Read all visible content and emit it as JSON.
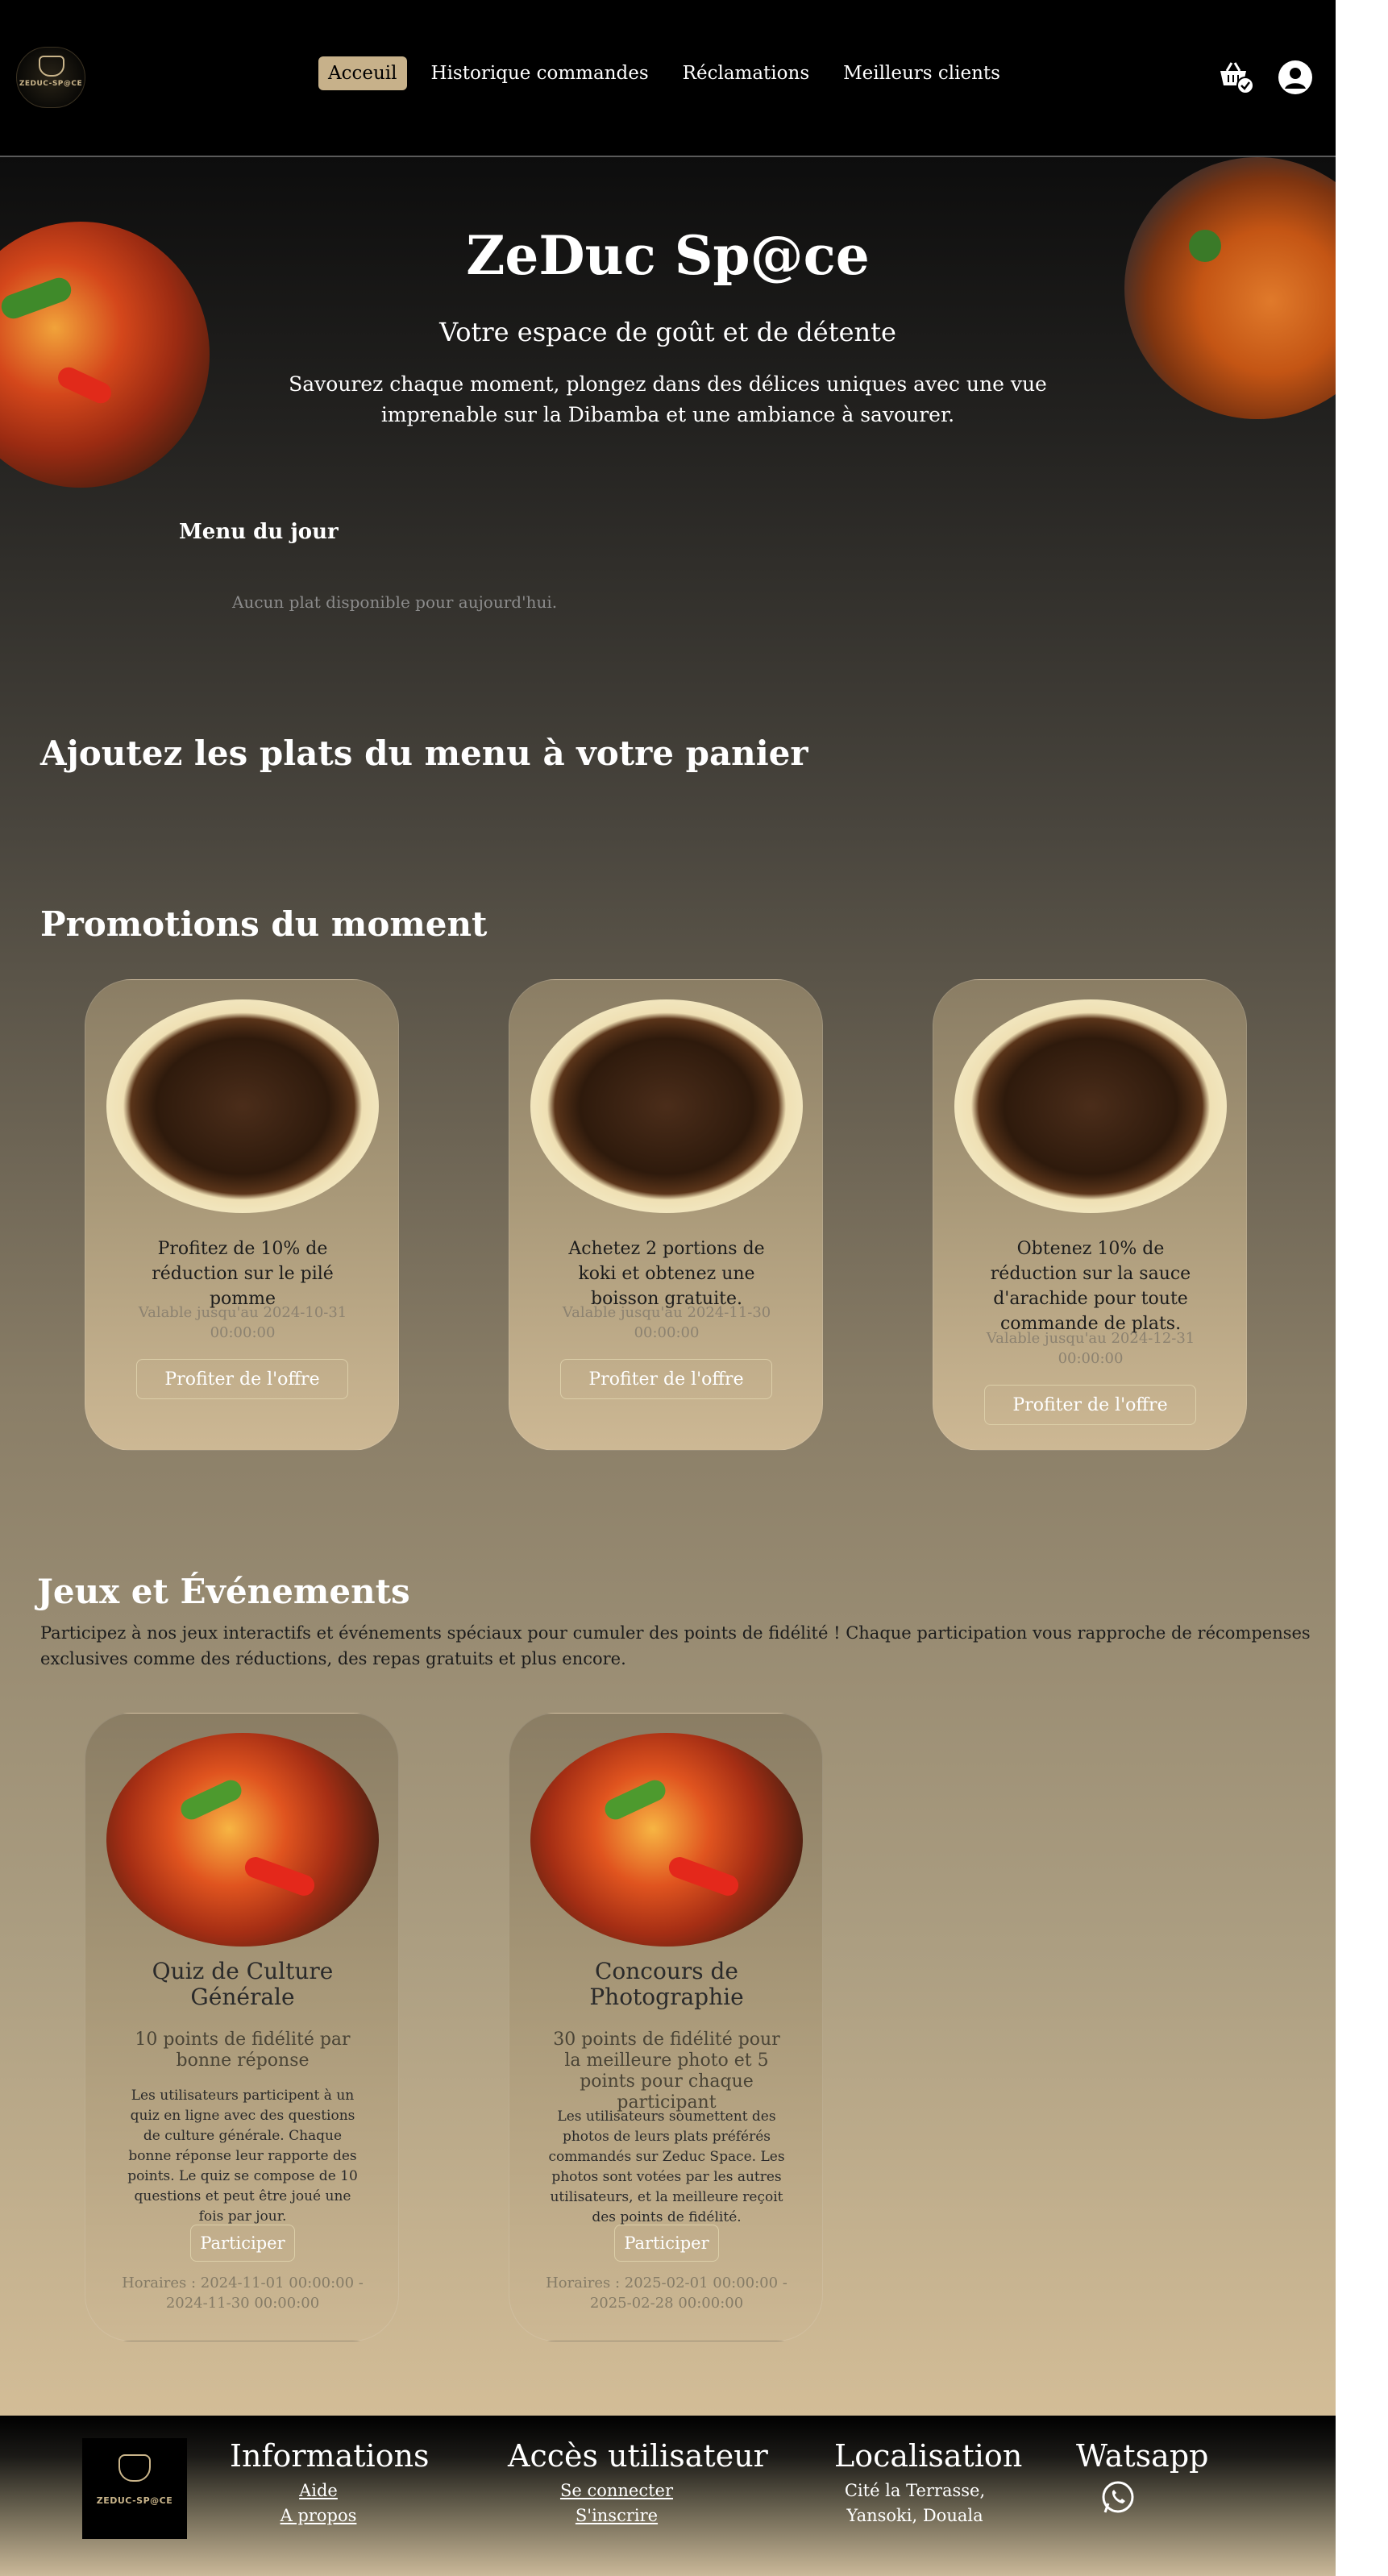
{
  "header": {
    "logo_text": "ZEDUC-SP@CE",
    "nav": [
      {
        "label": "Acceuil",
        "active": true
      },
      {
        "label": "Historique commandes"
      },
      {
        "label": "Réclamations"
      },
      {
        "label": "Meilleurs clients"
      }
    ],
    "icons": [
      "cart-check-icon",
      "user-circle-icon"
    ]
  },
  "hero": {
    "title": "ZeDuc Sp@ce",
    "subtitle": "Votre espace de goût et de détente",
    "description": "Savourez chaque moment, plongez dans des délices uniques avec une vue imprenable sur la Dibamba et une ambiance à savourer."
  },
  "menu_jour": {
    "title": "Menu du jour",
    "empty": "Aucun plat disponible pour aujourd'hui."
  },
  "panier": {
    "title": "Ajoutez les plats du menu à votre panier"
  },
  "promotions": {
    "title": "Promotions du moment",
    "button_label": "Profiter de l'offre",
    "items": [
      {
        "text": "Profitez de 10% de réduction sur le pilé pomme",
        "valid": "Valable jusqu'au 2024-10-31 00:00:00"
      },
      {
        "text": "Achetez 2 portions de koki et obtenez une boisson gratuite.",
        "valid": "Valable jusqu'au 2024-11-30 00:00:00"
      },
      {
        "text": "Obtenez 10% de réduction sur la sauce d'arachide pour toute commande de plats.",
        "valid": "Valable jusqu'au 2024-12-31 00:00:00"
      }
    ]
  },
  "events": {
    "title": "Jeux et Événements",
    "description": "Participez à nos jeux interactifs et événements spéciaux pour cumuler des points de fidélité ! Chaque participation vous rapproche de récompenses exclusives comme des réductions, des repas gratuits et plus encore.",
    "button_label": "Participer",
    "items": [
      {
        "title": "Quiz de Culture Générale",
        "points": "10 points de fidélité par bonne réponse",
        "desc": "Les utilisateurs participent à un quiz en ligne avec des questions de culture générale. Chaque bonne réponse leur rapporte des points. Le quiz se compose de 10 questions et peut être joué une fois par jour.",
        "hours": "Horaires : 2024-11-01 00:00:00 - 2024-11-30 00:00:00"
      },
      {
        "title": "Concours de Photographie",
        "points": "30 points de fidélité pour la meilleure photo et 5 points pour chaque participant",
        "desc": "Les utilisateurs soumettent des photos de leurs plats préférés commandés sur Zeduc Space. Les photos sont votées par les autres utilisateurs, et la meilleure reçoit des points de fidélité.",
        "hours": "Horaires : 2025-02-01 00:00:00 - 2025-02-28 00:00:00"
      }
    ]
  },
  "footer": {
    "logo_text": "ZEDUC-SP@CE",
    "informations": {
      "title": "Informations",
      "links": [
        "Aide",
        "A propos"
      ]
    },
    "acces": {
      "title": "Accès utilisateur",
      "links": [
        "Se connecter",
        "S'inscrire"
      ]
    },
    "localisation": {
      "title": "Localisation",
      "lines": [
        "Cité la Terrasse,",
        "Yansoki, Douala"
      ]
    },
    "watsapp": {
      "title": "Watsapp",
      "icon": "whatsapp-icon"
    }
  },
  "colors": {
    "header_bg": "#000000",
    "accent": "#c7b18a",
    "gradient_bottom": "#d3bd97"
  }
}
